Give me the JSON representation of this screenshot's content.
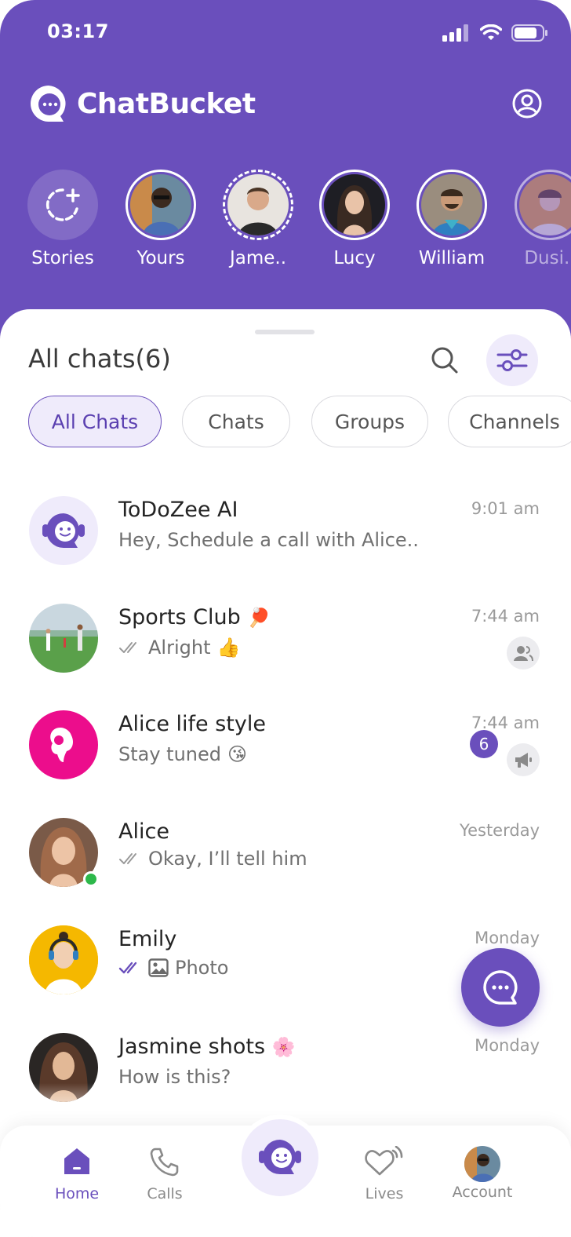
{
  "status_bar": {
    "time": "03:17"
  },
  "app": {
    "name": "ChatBucket"
  },
  "stories": [
    {
      "name": "Stories",
      "type": "add"
    },
    {
      "name": "Yours"
    },
    {
      "name": "Jame.."
    },
    {
      "name": "Lucy"
    },
    {
      "name": "William"
    },
    {
      "name": "Dusi.."
    }
  ],
  "chats_header": {
    "title": "All chats(6)"
  },
  "filters": [
    "All Chats",
    "Chats",
    "Groups",
    "Channels"
  ],
  "active_filter": "All Chats",
  "chats": [
    {
      "name": "ToDoZee AI",
      "message": "Hey, Schedule a call with Alice..",
      "time": "9:01 am"
    },
    {
      "name": "Sports Club",
      "name_emoji": "🏓",
      "message": "Alright",
      "message_emoji": "👍",
      "time": "7:44 am",
      "read": true,
      "kind": "group"
    },
    {
      "name": "Alice life style",
      "message": "Stay tuned",
      "message_emoji": "😘",
      "time": "7:44 am",
      "unread": "6",
      "kind": "channel"
    },
    {
      "name": "Alice",
      "message": "Okay, I’ll tell him",
      "time": "Yesterday",
      "read": true,
      "online": true
    },
    {
      "name": "Emily",
      "message": "Photo",
      "time": "Monday",
      "read": true,
      "attachment": "photo-icon"
    },
    {
      "name": "Jasmine shots",
      "name_emoji": "🌸",
      "message": "How is this?",
      "time": "Monday"
    }
  ],
  "bottom_nav": [
    {
      "label": "Home",
      "active": true
    },
    {
      "label": "Calls"
    },
    {
      "label": ""
    },
    {
      "label": "Lives"
    },
    {
      "label": "Account"
    }
  ],
  "colors": {
    "brand": "#6a4fbc",
    "brand_light": "#efebfb",
    "online": "#2db84a",
    "alice_life_style_avatar": "#ec0d8c",
    "emily_avatar": "#f5b800"
  }
}
